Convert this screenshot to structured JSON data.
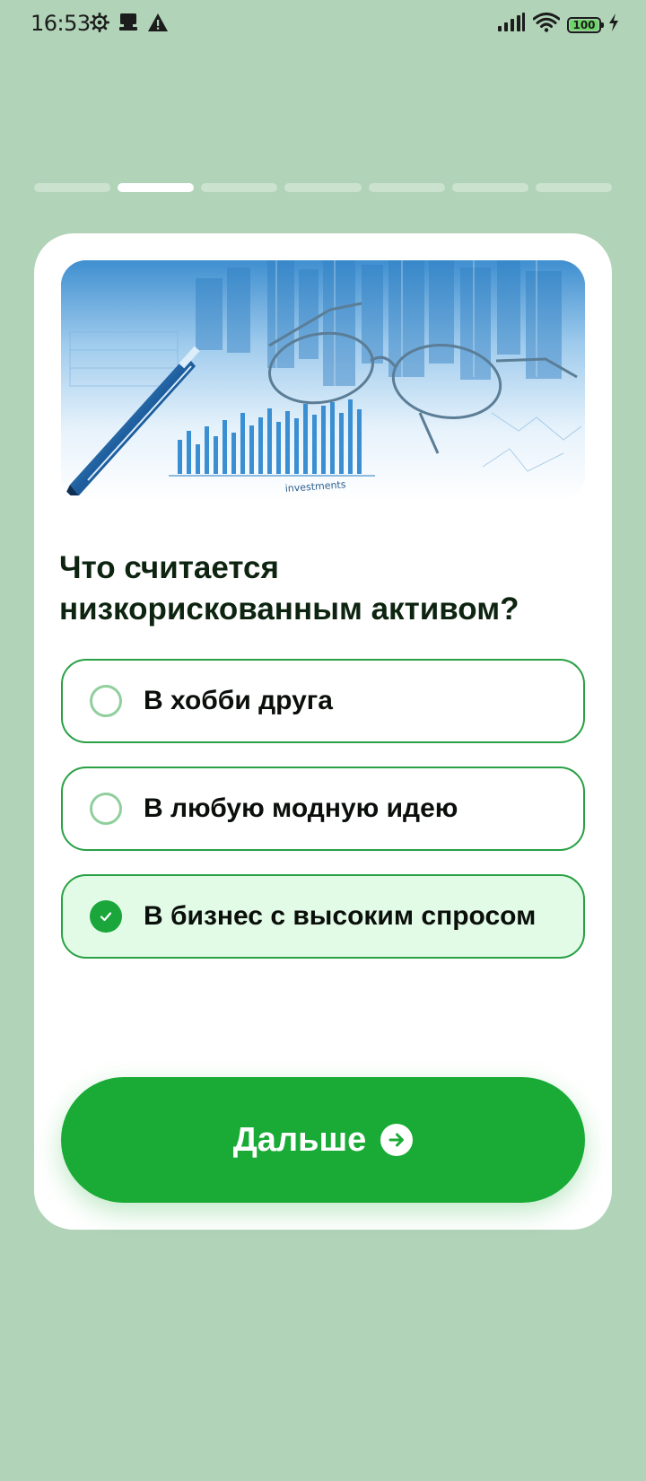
{
  "status_bar": {
    "time": "16:53",
    "battery": "100"
  },
  "progress": {
    "total": 7,
    "current": 2
  },
  "colors": {
    "background": "#b1d3b8",
    "accent": "#19ab36",
    "option_border": "#29a044",
    "selected_fill": "#e2fbe6"
  },
  "quiz": {
    "image_icon": "finance-charts-glasses-pen-image",
    "question": "Что считается низкорискованным активом?",
    "options": [
      {
        "label": "В хобби друга",
        "selected": false
      },
      {
        "label": "В любую модную идею",
        "selected": false
      },
      {
        "label": "В бизнес с высоким спросом",
        "selected": true
      }
    ],
    "next_label": "Дальше",
    "next_icon": "arrow-right-circle-icon"
  }
}
